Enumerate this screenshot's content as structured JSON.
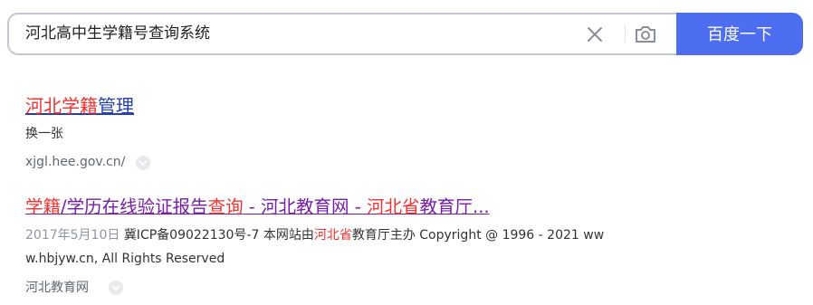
{
  "search": {
    "query": "河北高中生学籍号查询系统",
    "button_label": "百度一下"
  },
  "results": [
    {
      "title_parts": [
        {
          "text": "河北学籍",
          "highlight": true
        },
        {
          "text": "管理",
          "highlight": false
        }
      ],
      "snippet": "换一张",
      "source": "xjgl.hee.gov.cn/"
    },
    {
      "title_parts": [
        {
          "text": "学籍",
          "highlight": true
        },
        {
          "text": "/学历在线验证报告",
          "highlight": false
        },
        {
          "text": "查询",
          "highlight": true
        },
        {
          "text": " - 河北教育网 - ",
          "highlight": false
        },
        {
          "text": "河北省",
          "highlight": true
        },
        {
          "text": "教育厅...",
          "highlight": false
        }
      ],
      "date": "2017年5月10日",
      "snippet_before": "冀ICP备09022130号-7 本网站由",
      "snippet_highlight": "河北省",
      "snippet_after": "教育厅主办 Copyright @ 1996 - 2021 ww",
      "snippet_line2": "w.hbjyw.cn, All Rights Reserved",
      "source": "河北教育网"
    }
  ],
  "colors": {
    "accent": "#4e6ef2",
    "highlight": "#f73131",
    "link": "#2440b3",
    "visited_link": "#771caa"
  },
  "icons": {
    "clear": "close-icon",
    "camera": "camera-icon",
    "more": "chevron-down-icon"
  }
}
